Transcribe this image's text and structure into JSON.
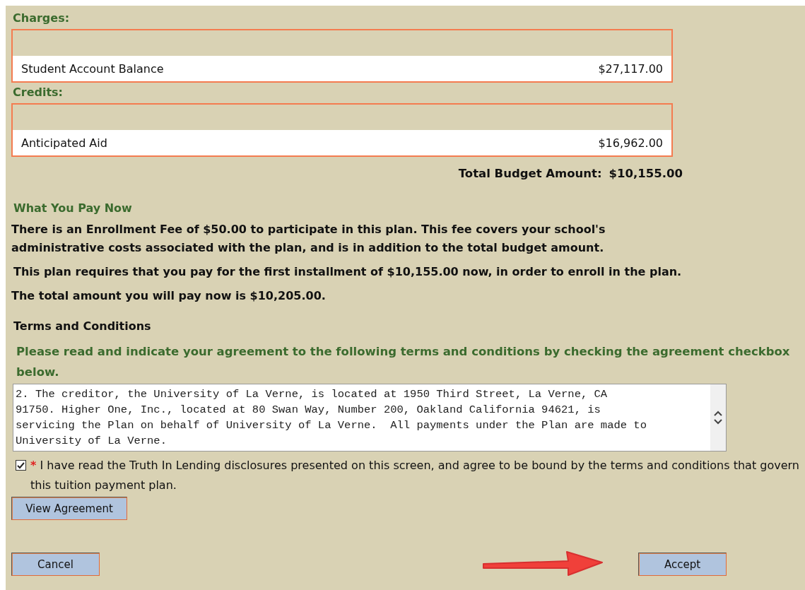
{
  "charges": {
    "title": "Charges:",
    "rows": [
      {
        "label": "Student Account Balance",
        "amount": "$27,117.00"
      }
    ]
  },
  "credits": {
    "title": "Credits:",
    "rows": [
      {
        "label": "Anticipated Aid",
        "amount": "$16,962.00"
      }
    ]
  },
  "total": {
    "label": "Total Budget Amount:",
    "amount": "$10,155.00"
  },
  "pay_now": {
    "title": "What You Pay Now",
    "paragraphs": [
      "There is an Enrollment Fee of $50.00 to participate in this plan. This fee covers your school's administrative costs associated with the plan, and is in addition to the total budget amount.",
      "This plan requires that you pay for the first installment of $10,155.00 now, in order to enroll in the plan.",
      "The total amount you will pay now is $10,205.00."
    ]
  },
  "terms": {
    "title": "Terms and Conditions",
    "instruction": "Please read and indicate your agreement to the following terms and conditions by checking the agreement checkbox below.",
    "text": "2. The creditor, the University of La Verne, is located at 1950 Third Street, La Verne, CA\n91750. Higher One, Inc., located at 80 Swan Way, Number 200, Oakland California 94621, is\nservicing the Plan on behalf of University of La Verne.  All payments under the Plan are made to\nUniversity of La Verne."
  },
  "agreement": {
    "checked": true,
    "required_mark": "*",
    "label": "I have read the Truth In Lending disclosures presented on this screen, and agree to be bound by the terms and conditions that govern this tuition payment plan."
  },
  "buttons": [
    {
      "kind": "view",
      "label": "View Agreement"
    },
    {
      "kind": "cancel",
      "label": "Cancel"
    },
    {
      "kind": "accept",
      "label": "Accept"
    }
  ]
}
